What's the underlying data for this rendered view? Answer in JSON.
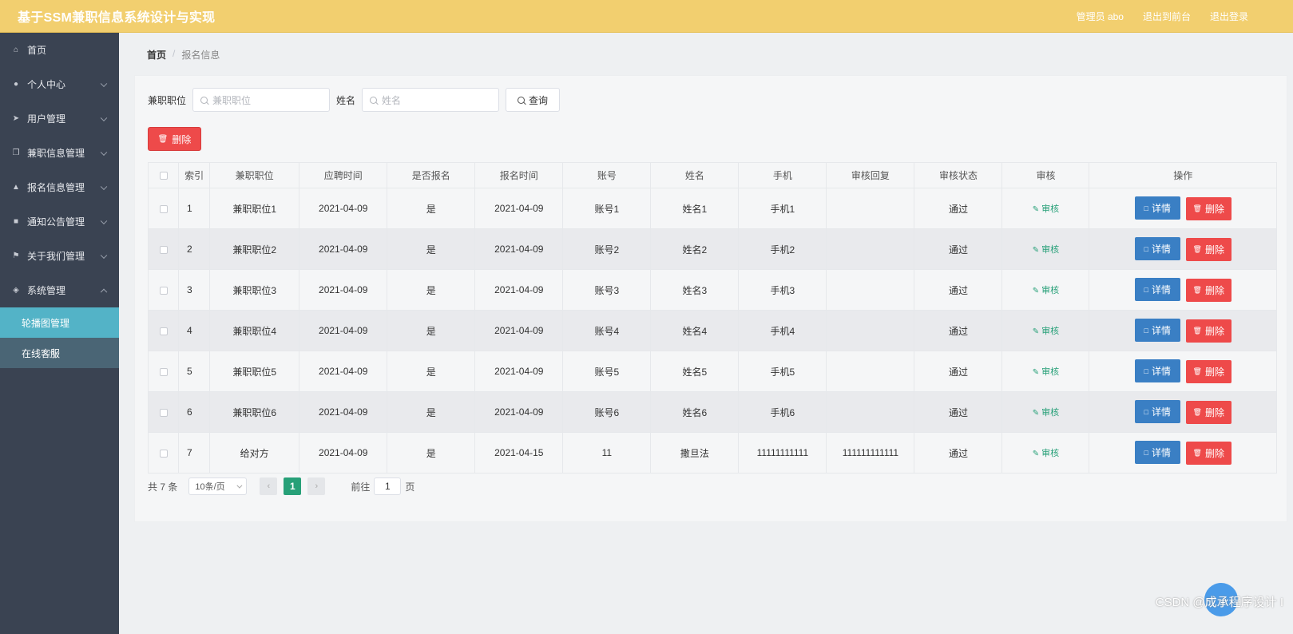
{
  "header": {
    "title": "基于SSM兼职信息系统设计与实现",
    "user_label": "管理员 abo",
    "front_label": "退出到前台",
    "logout_label": "退出登录"
  },
  "sidebar": {
    "items": [
      {
        "label": "首页",
        "icon": "home-icon"
      },
      {
        "label": "个人中心",
        "icon": "user-icon"
      },
      {
        "label": "用户管理",
        "icon": "send-icon"
      },
      {
        "label": "兼职信息管理",
        "icon": "copy-icon"
      },
      {
        "label": "报名信息管理",
        "icon": "thumb-icon"
      },
      {
        "label": "通知公告管理",
        "icon": "monitor-icon"
      },
      {
        "label": "关于我们管理",
        "icon": "flag-icon"
      },
      {
        "label": "系统管理",
        "icon": "compass-icon"
      }
    ],
    "sub_items": [
      {
        "label": "轮播图管理"
      },
      {
        "label": "在线客服"
      }
    ]
  },
  "breadcrumb": {
    "home": "首页",
    "sep": "/",
    "current": "报名信息"
  },
  "search": {
    "job_label": "兼职职位",
    "job_placeholder": "兼职职位",
    "name_label": "姓名",
    "name_placeholder": "姓名",
    "query_label": "查询"
  },
  "toolbar": {
    "delete_label": "删除"
  },
  "table": {
    "headers": [
      "索引",
      "兼职职位",
      "应聘时间",
      "是否报名",
      "报名时间",
      "账号",
      "姓名",
      "手机",
      "审核回复",
      "审核状态",
      "审核",
      "操作"
    ],
    "audit_label": "审核",
    "detail_label": "详情",
    "delete_label": "删除",
    "rows": [
      {
        "index": "1",
        "job": "兼职职位1",
        "apply_time": "2021-04-09",
        "signed": "是",
        "sign_time": "2021-04-09",
        "account": "账号1",
        "name": "姓名1",
        "phone": "手机1",
        "reply": "",
        "status": "通过"
      },
      {
        "index": "2",
        "job": "兼职职位2",
        "apply_time": "2021-04-09",
        "signed": "是",
        "sign_time": "2021-04-09",
        "account": "账号2",
        "name": "姓名2",
        "phone": "手机2",
        "reply": "",
        "status": "通过"
      },
      {
        "index": "3",
        "job": "兼职职位3",
        "apply_time": "2021-04-09",
        "signed": "是",
        "sign_time": "2021-04-09",
        "account": "账号3",
        "name": "姓名3",
        "phone": "手机3",
        "reply": "",
        "status": "通过"
      },
      {
        "index": "4",
        "job": "兼职职位4",
        "apply_time": "2021-04-09",
        "signed": "是",
        "sign_time": "2021-04-09",
        "account": "账号4",
        "name": "姓名4",
        "phone": "手机4",
        "reply": "",
        "status": "通过"
      },
      {
        "index": "5",
        "job": "兼职职位5",
        "apply_time": "2021-04-09",
        "signed": "是",
        "sign_time": "2021-04-09",
        "account": "账号5",
        "name": "姓名5",
        "phone": "手机5",
        "reply": "",
        "status": "通过"
      },
      {
        "index": "6",
        "job": "兼职职位6",
        "apply_time": "2021-04-09",
        "signed": "是",
        "sign_time": "2021-04-09",
        "account": "账号6",
        "name": "姓名6",
        "phone": "手机6",
        "reply": "",
        "status": "通过"
      },
      {
        "index": "7",
        "job": "给对方",
        "apply_time": "2021-04-09",
        "signed": "是",
        "sign_time": "2021-04-15",
        "account": "11",
        "name": "撒旦法",
        "phone": "11111111111",
        "reply": "111111111111",
        "status": "通过"
      }
    ]
  },
  "pager": {
    "total": "共 7 条",
    "page_size": "10条/页",
    "current_page": "1",
    "goto_prefix": "前往",
    "goto_value": "1",
    "goto_suffix": "页"
  },
  "watermark": "CSDN @成承程序设计 I",
  "colors": {
    "header": "#f2cf6f",
    "sidebar": "#3a4352",
    "accent": "#27a078",
    "danger": "#ee4a4a",
    "primary": "#3a7fc4"
  }
}
